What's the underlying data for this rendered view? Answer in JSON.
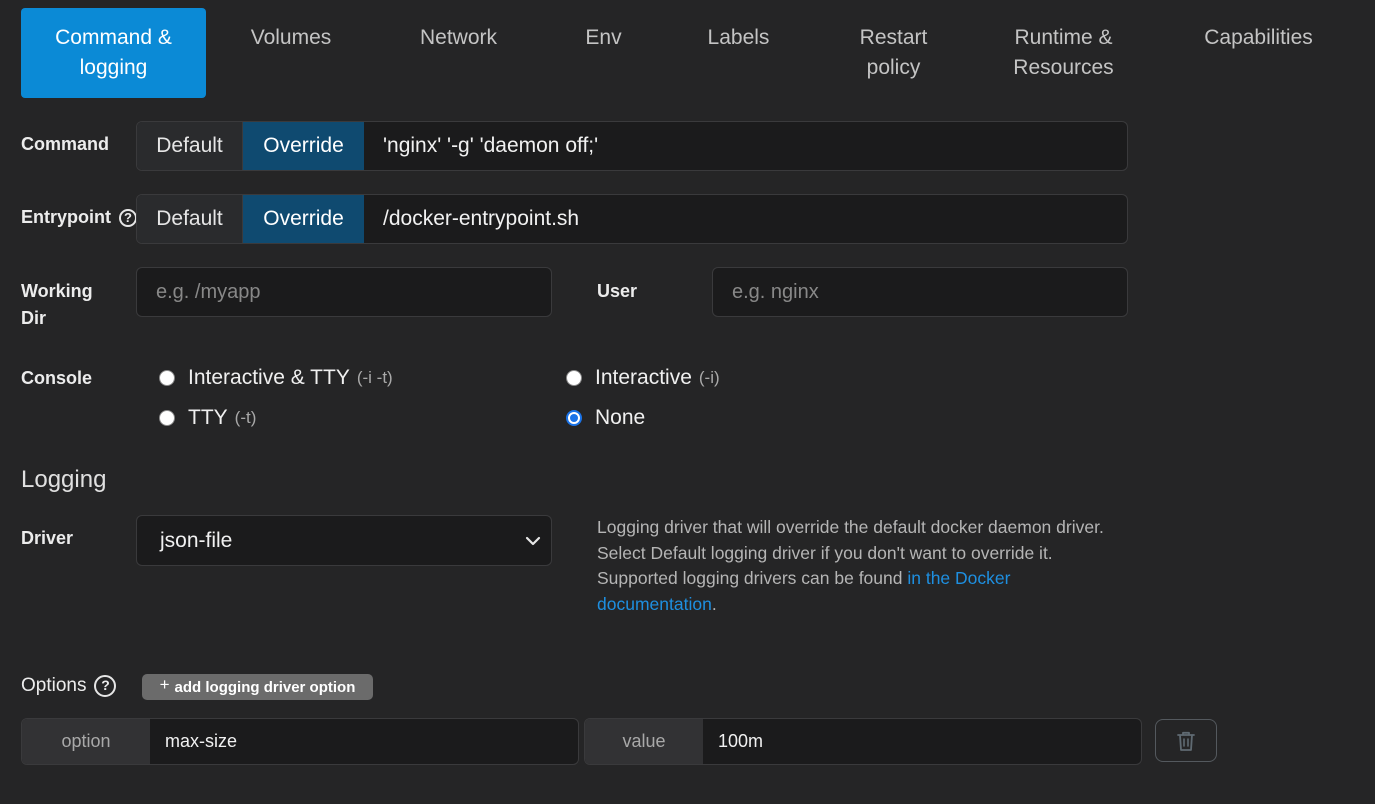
{
  "tabs": [
    {
      "line1": "Command &",
      "line2": "logging"
    },
    {
      "line1": "Volumes",
      "line2": ""
    },
    {
      "line1": "Network",
      "line2": ""
    },
    {
      "line1": "Env",
      "line2": ""
    },
    {
      "line1": "Labels",
      "line2": ""
    },
    {
      "line1": "Restart",
      "line2": "policy"
    },
    {
      "line1": "Runtime &",
      "line2": "Resources"
    },
    {
      "line1": "Capabilities",
      "line2": ""
    }
  ],
  "command": {
    "label": "Command",
    "default_label": "Default",
    "override_label": "Override",
    "value": "'nginx' '-g' 'daemon off;'"
  },
  "entrypoint": {
    "label": "Entrypoint",
    "help_glyph": "?",
    "default_label": "Default",
    "override_label": "Override",
    "value": "/docker-entrypoint.sh"
  },
  "working_dir": {
    "label_line1": "Working",
    "label_line2": "Dir",
    "placeholder": "e.g. /myapp"
  },
  "user": {
    "label": "User",
    "placeholder": "e.g. nginx"
  },
  "console": {
    "label": "Console",
    "options": [
      {
        "label": "Interactive & TTY",
        "hint": "(-i -t)",
        "checked": false
      },
      {
        "label": "Interactive",
        "hint": "(-i)",
        "checked": false
      },
      {
        "label": "TTY",
        "hint": "(-t)",
        "checked": false
      },
      {
        "label": "None",
        "hint": "",
        "checked": true
      }
    ]
  },
  "logging": {
    "title": "Logging",
    "driver_label": "Driver",
    "driver_value": "json-file",
    "help_text": "Logging driver that will override the default docker daemon driver. Select Default logging driver if you don't want to override it. Supported logging drivers can be found ",
    "help_link": "in the Docker documentation",
    "help_end": ".",
    "options_label": "Options",
    "options_help_glyph": "?",
    "add_button_plus": "+",
    "add_button_label": "add logging driver option",
    "rows": [
      {
        "option_addon": "option",
        "option_value": "max-size",
        "value_addon": "value",
        "value_value": "100m"
      }
    ]
  },
  "colors": {
    "accent": "#0b8ad6",
    "override_bg": "#0f4a70",
    "link": "#1e8fe0",
    "background": "#252526"
  },
  "icons": {
    "select_chevron": "chevron-down-icon",
    "delete": "trash-icon",
    "help": "help-circle-icon"
  }
}
